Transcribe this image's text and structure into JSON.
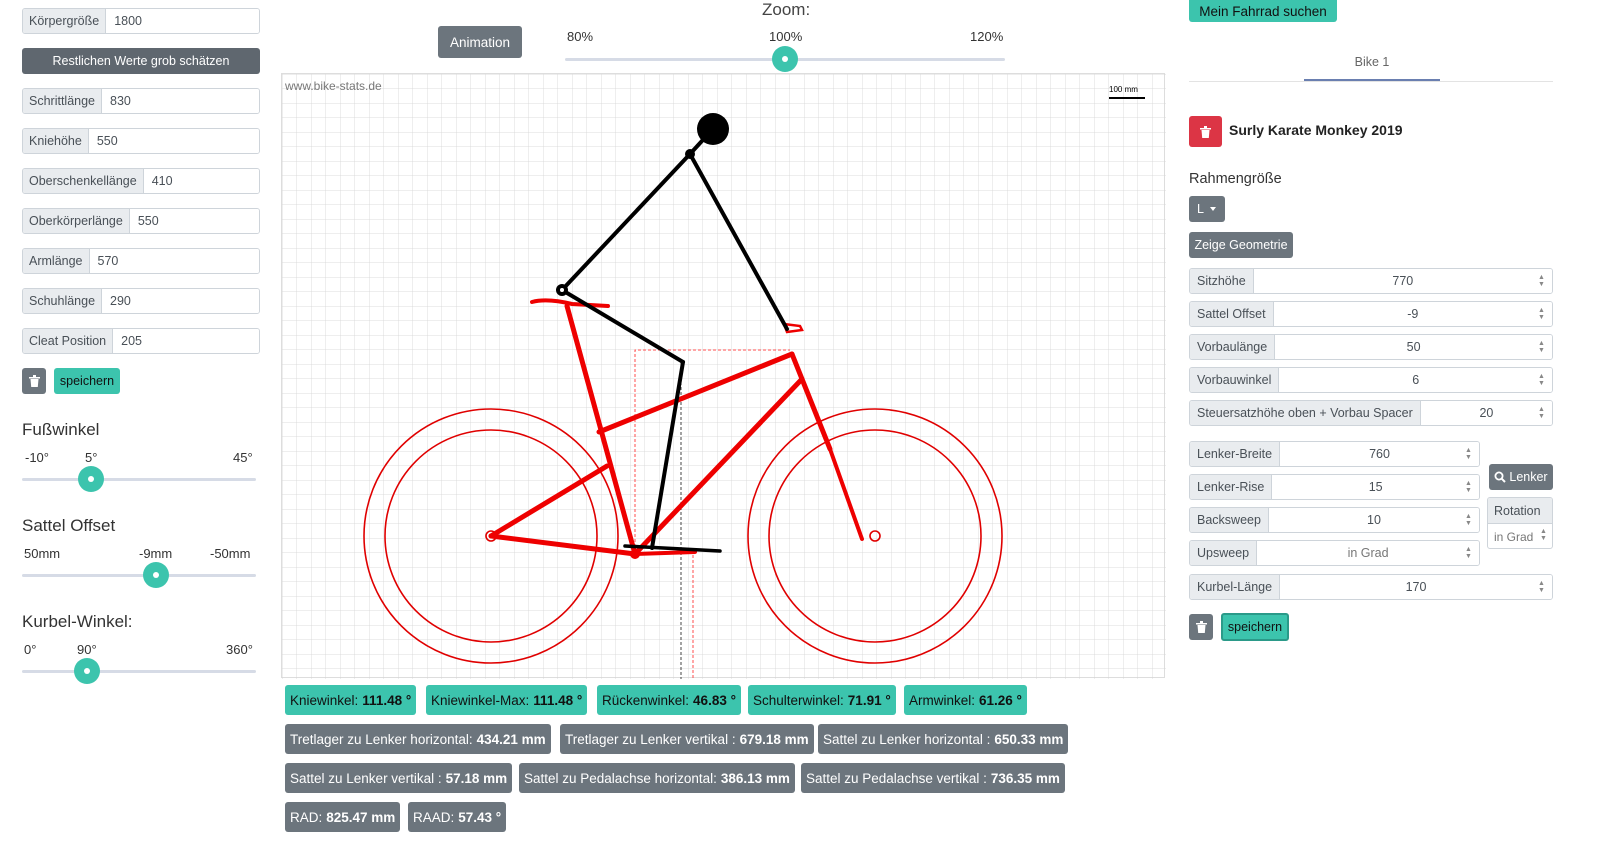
{
  "left": {
    "body_height": {
      "label": "Körpergröße",
      "value": "1800"
    },
    "estimate_button": "Restlichen Werte grob schätzen",
    "fields": [
      {
        "label": "Schrittlänge",
        "value": "830"
      },
      {
        "label": "Kniehöhe",
        "value": "550"
      },
      {
        "label": "Oberschenkellänge",
        "value": "410"
      },
      {
        "label": "Oberkörperlänge",
        "value": "550"
      },
      {
        "label": "Armlänge",
        "value": "570"
      },
      {
        "label": "Schuhlänge",
        "value": "290"
      },
      {
        "label": "Cleat Position",
        "value": "205"
      }
    ],
    "save_label": "speichern",
    "sliders": {
      "foot": {
        "title": "Fußwinkel",
        "min": "-10°",
        "mid": "5°",
        "max": "45°",
        "value": 5
      },
      "saddle": {
        "title": "Sattel Offset",
        "min": "50mm",
        "mid": "-9mm",
        "max": "-50mm",
        "value": -9
      },
      "crank": {
        "title": "Kurbel-Winkel:",
        "min": "0°",
        "mid": "90°",
        "max": "360°",
        "value": 90
      }
    }
  },
  "center": {
    "zoom_title": "Zoom:",
    "animation_label": "Animation",
    "zoom": {
      "min": "80%",
      "mid": "100%",
      "max": "120%",
      "value": 100
    },
    "watermark": "www.bike-stats.de",
    "scale_label": "100 mm",
    "badges_row1": [
      {
        "label": "Kniewinkel:",
        "value": "111.48 °"
      },
      {
        "label": "Kniewinkel-Max:",
        "value": "111.48 °"
      },
      {
        "label": "Rückenwinkel:",
        "value": "46.83 °"
      },
      {
        "label": "Schulterwinkel:",
        "value": "71.91 °"
      },
      {
        "label": "Armwinkel:",
        "value": "61.26 °"
      }
    ],
    "badges_row2": [
      {
        "label": "Tretlager zu Lenker horizontal:",
        "value": "434.21 mm"
      },
      {
        "label": "Tretlager zu Lenker vertikal :",
        "value": "679.18 mm"
      },
      {
        "label": "Sattel zu Lenker horizontal :",
        "value": "650.33 mm"
      }
    ],
    "badges_row3": [
      {
        "label": "Sattel zu Lenker vertikal :",
        "value": "57.18 mm"
      },
      {
        "label": "Sattel zu Pedalachse horizontal:",
        "value": "386.13 mm"
      },
      {
        "label": "Sattel zu Pedalachse vertikal :",
        "value": "736.35 mm"
      }
    ],
    "badges_row4": [
      {
        "label": "RAD:",
        "value": "825.47 mm"
      },
      {
        "label": "RAAD:",
        "value": "57.43 °"
      }
    ]
  },
  "right": {
    "find_bike_button": "Mein Fahrrad suchen",
    "tab": "Bike 1",
    "bike_name": "Surly Karate Monkey 2019",
    "frame_size_title": "Rahmengröße",
    "frame_size_value": "L",
    "geometry_button": "Zeige Geometrie",
    "fields": [
      {
        "label": "Sitzhöhe",
        "value": "770"
      },
      {
        "label": "Sattel Offset",
        "value": "-9"
      },
      {
        "label": "Vorbaulänge",
        "value": "50"
      },
      {
        "label": "Vorbauwinkel",
        "value": "6"
      },
      {
        "label": "Steuersatzhöhe oben + Vorbau Spacer",
        "value": "20"
      }
    ],
    "bar_fields": [
      {
        "label": "Lenker-Breite",
        "value": "760"
      },
      {
        "label": "Lenker-Rise",
        "value": "15"
      },
      {
        "label": "Backsweep",
        "value": "10"
      },
      {
        "label": "Upsweep",
        "value": "in Grad"
      }
    ],
    "crank": {
      "label": "Kurbel-Länge",
      "value": "170"
    },
    "lenker_button": "Lenker",
    "rotation": {
      "label": "Rotation",
      "placeholder": "in Grad"
    },
    "save_label": "speichern"
  },
  "colors": {
    "accent": "#3cc4ad",
    "secondary": "#6c757d",
    "danger": "#dc3545",
    "bike": "#ff0000"
  }
}
